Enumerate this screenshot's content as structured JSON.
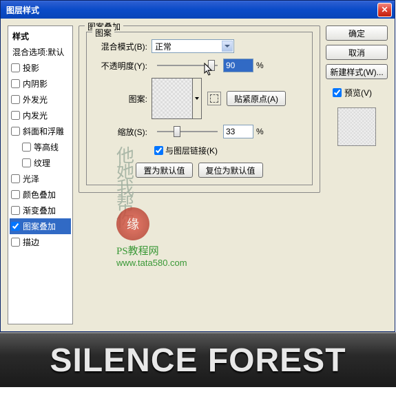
{
  "window": {
    "title": "图层样式"
  },
  "styles": {
    "header": "样式",
    "blending_opts": "混合选项:默认",
    "items": [
      {
        "label": "投影",
        "checked": false
      },
      {
        "label": "内阴影",
        "checked": false
      },
      {
        "label": "外发光",
        "checked": false
      },
      {
        "label": "内发光",
        "checked": false
      },
      {
        "label": "斜面和浮雕",
        "checked": false
      },
      {
        "label": "等高线",
        "checked": false,
        "indent": true
      },
      {
        "label": "纹理",
        "checked": false,
        "indent": true
      },
      {
        "label": "光泽",
        "checked": false
      },
      {
        "label": "颜色叠加",
        "checked": false
      },
      {
        "label": "渐变叠加",
        "checked": false
      },
      {
        "label": "图案叠加",
        "checked": true,
        "selected": true
      },
      {
        "label": "描边",
        "checked": false
      }
    ]
  },
  "center": {
    "group_title": "图案叠加",
    "inner_title": "图案",
    "blend_mode_label": "混合模式(B):",
    "blend_mode_value": "正常",
    "opacity_label": "不透明度(Y):",
    "opacity_value": "90",
    "opacity_pct": "%",
    "pattern_label": "图案:",
    "snap_btn": "贴紧原点(A)",
    "scale_label": "缩放(S):",
    "scale_value": "33",
    "scale_pct": "%",
    "link_label": "与图层链接(K)",
    "make_default": "置为默认值",
    "reset_default": "复位为默认值"
  },
  "right": {
    "ok": "确定",
    "cancel": "取消",
    "new_style": "新建样式(W)...",
    "preview": "预览(V)"
  },
  "watermark": {
    "seal_chars": "他她我帮你",
    "site_name": "PS教程网",
    "url": "www.tata580.com"
  },
  "banner": {
    "text": "SILENCE FOREST"
  }
}
